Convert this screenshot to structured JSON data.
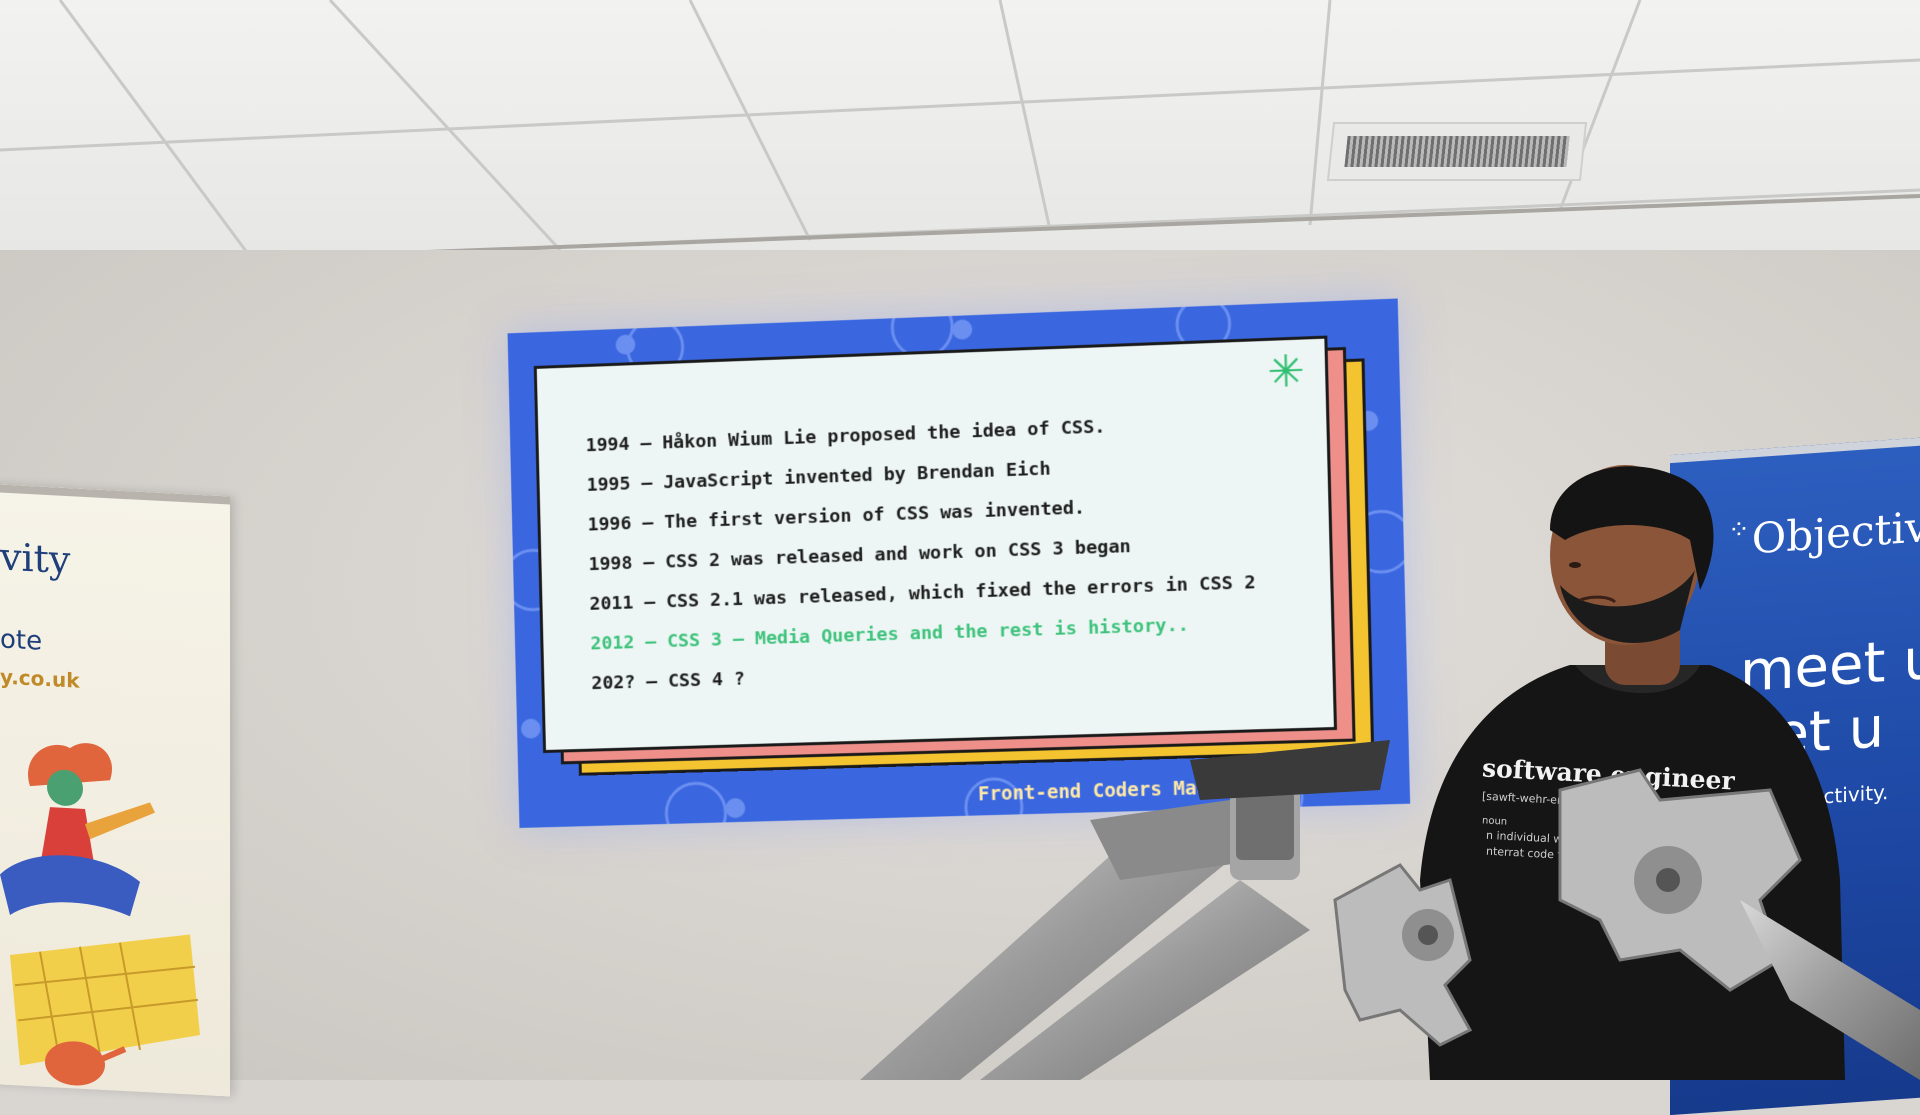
{
  "slide": {
    "lines": [
      "1994 – Håkon Wium Lie proposed the idea of CSS.",
      "1995 – JavaScript invented by Brendan Eich",
      "1996 – The first version of CSS was invented.",
      "1998 – CSS 2 was released and work on CSS 3 began",
      "2011 – CSS 2.1 was released, which fixed the errors in CSS 2",
      "2012 – CSS 3 – Media Queries and the rest is history..",
      "202? – CSS 4 ?"
    ],
    "highlight_color": "#3ec27c",
    "footer": "Front-end Coders Mauritius",
    "decoration_icon": "asterisk-icon"
  },
  "banner_left": {
    "word1": "vity",
    "word2": "ote",
    "word3": "y.co.uk"
  },
  "banner_right": {
    "logo": "Objectivi",
    "line1": "meet u",
    "line2": "eet u",
    "url": "ijectivity."
  },
  "presenter": {
    "shirt_title": "software engineer",
    "shirt_phonetic": "[sawft-wehr-enji",
    "shirt_pos": "noun",
    "shirt_def1": "n individual who speci",
    "shirt_def2": "nterrat code from coffe"
  },
  "colors": {
    "slide_background": "#3a67e0",
    "card": "#edf6f4",
    "pink_layer": "#ee8f8a",
    "yellow_layer": "#f4c430",
    "banner_right": "#1d47a3"
  }
}
